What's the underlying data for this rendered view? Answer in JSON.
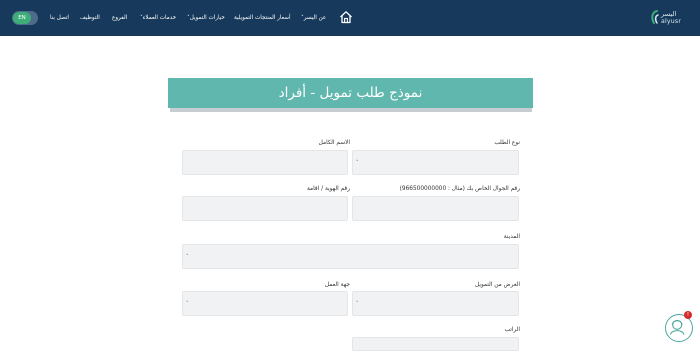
{
  "nav": {
    "logo_ar": "اليسر",
    "logo_en": "alyusr",
    "items": [
      {
        "label": "عن اليسر˅"
      },
      {
        "label": "أسعار المنتجات التمويلية"
      },
      {
        "label": "خيارات التمويل˅"
      },
      {
        "label": "خدمات العملاء˅"
      },
      {
        "label": "الفروع"
      },
      {
        "label": "التوظيف"
      },
      {
        "label": "اتصل بنا"
      }
    ],
    "lang": "EN",
    "icons": {
      "home": "home-icon",
      "logo": "logo-icon",
      "chat": "chat-agent-icon"
    }
  },
  "banner": {
    "title": "نموذج طلب تمويل - أفراد"
  },
  "form": {
    "loan_type_label": "نوع الطلب",
    "full_name_label": "الاسم الكامل",
    "mobile_label": "رقم الجوال الخاص بك (مثال : 966500000000)",
    "id_label": "رقم الهوية / اقامة",
    "city_label": "المدينة",
    "purpose_label": "الغرض من التمويل",
    "employer_label": "جهة العمل",
    "salary_label": "الراتب",
    "arrow": "˅"
  },
  "chat": {
    "badge": "!"
  },
  "colors": {
    "nav": "#173a5c",
    "banner": "#60b7ae",
    "accent": "#3dae78",
    "field": "#f1f2f3",
    "badge": "#d62b2b"
  }
}
